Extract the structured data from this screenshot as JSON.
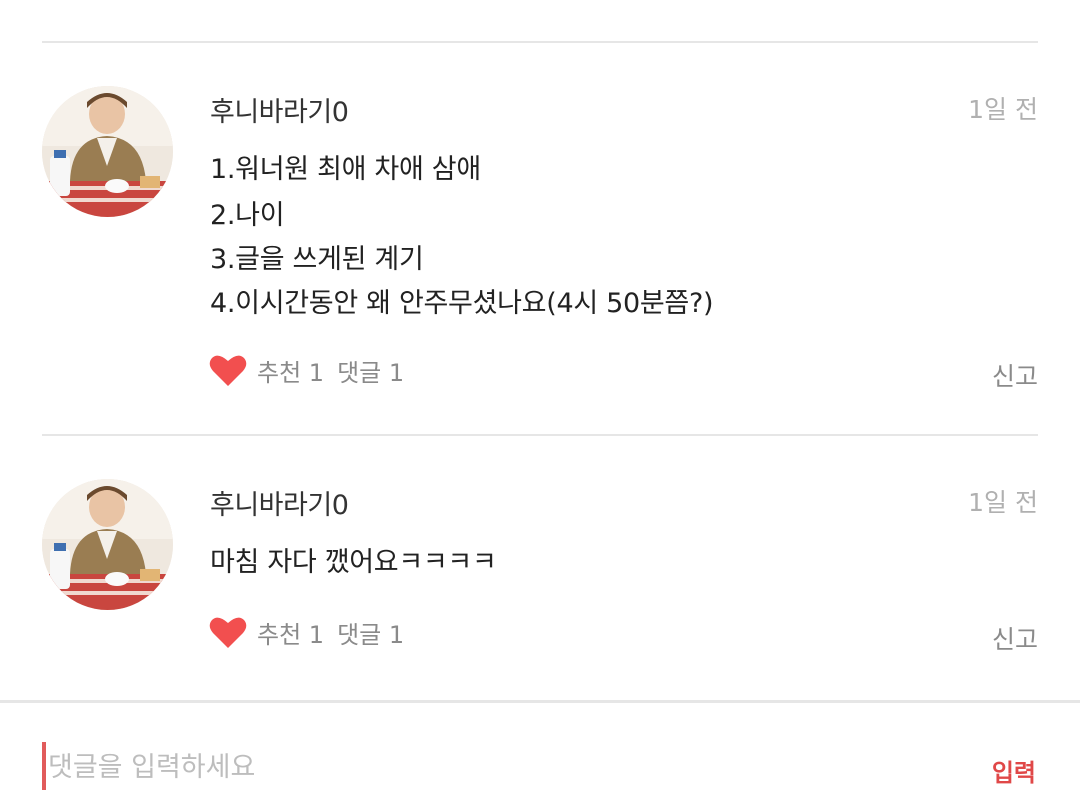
{
  "comments": [
    {
      "author": "후니바라기0",
      "time": "1일 전",
      "lines": [
        "1.워너원 최애 차애 삼애",
        "2.나이",
        "3.글을 쓰게된 계기",
        "4.이시간동안 왜 안주무셨나요(4시 50분쯤?)"
      ],
      "recommend": "추천 1",
      "replies": "댓글 1",
      "report": "신고"
    },
    {
      "author": "후니바라기0",
      "time": "1일 전",
      "lines": [
        "마침 자다 깼어요ㅋㅋㅋㅋ"
      ],
      "recommend": "추천 1",
      "replies": "댓글 1",
      "report": "신고"
    }
  ],
  "input": {
    "placeholder": "댓글을 입력하세요",
    "submit_label": "입력"
  },
  "colors": {
    "heart": "#f24f4f",
    "submit": "#e04848",
    "cursor": "#e15b5b"
  }
}
